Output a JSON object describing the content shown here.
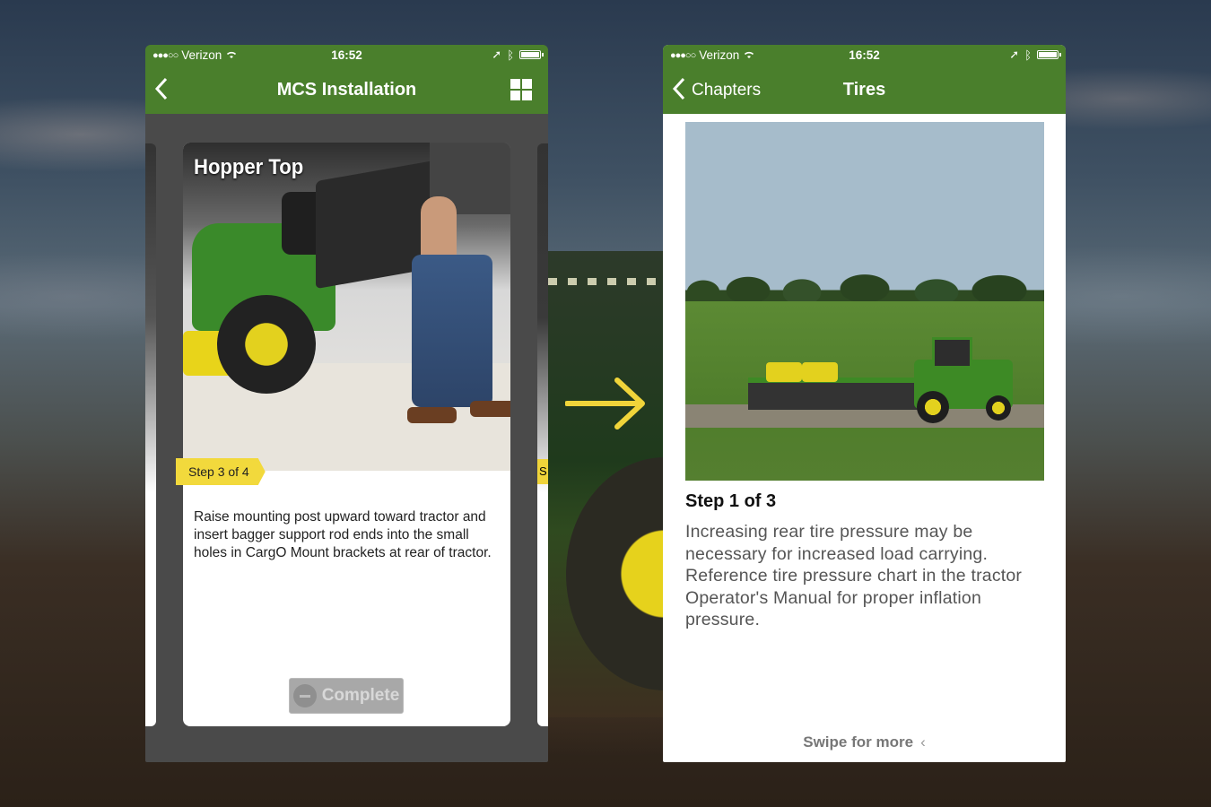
{
  "left_phone": {
    "status": {
      "carrier": "Verizon",
      "time": "16:52"
    },
    "nav": {
      "title": "MCS Installation"
    },
    "card": {
      "title": "Hopper Top",
      "step": "Step 3 of 4",
      "text": "Raise mounting post upward toward tractor and insert bagger support rod ends into the small holes in CargO Mount brackets at rear of tractor.",
      "complete_label": "Complete"
    },
    "peek_badge": "S"
  },
  "right_phone": {
    "status": {
      "carrier": "Verizon",
      "time": "16:52"
    },
    "nav": {
      "back_label": "Chapters",
      "title": "Tires"
    },
    "step_heading": "Step 1 of 3",
    "step_text": "Increasing rear tire pressure may be necessary for increased load carrying. Reference tire pressure chart in the tractor Operator's Manual for proper inflation pressure.",
    "swipe_hint": "Swipe for more"
  },
  "colors": {
    "brand_green": "#4a7f2c",
    "badge_yellow": "#f2d93c",
    "arrow_yellow": "#f0d43a"
  }
}
